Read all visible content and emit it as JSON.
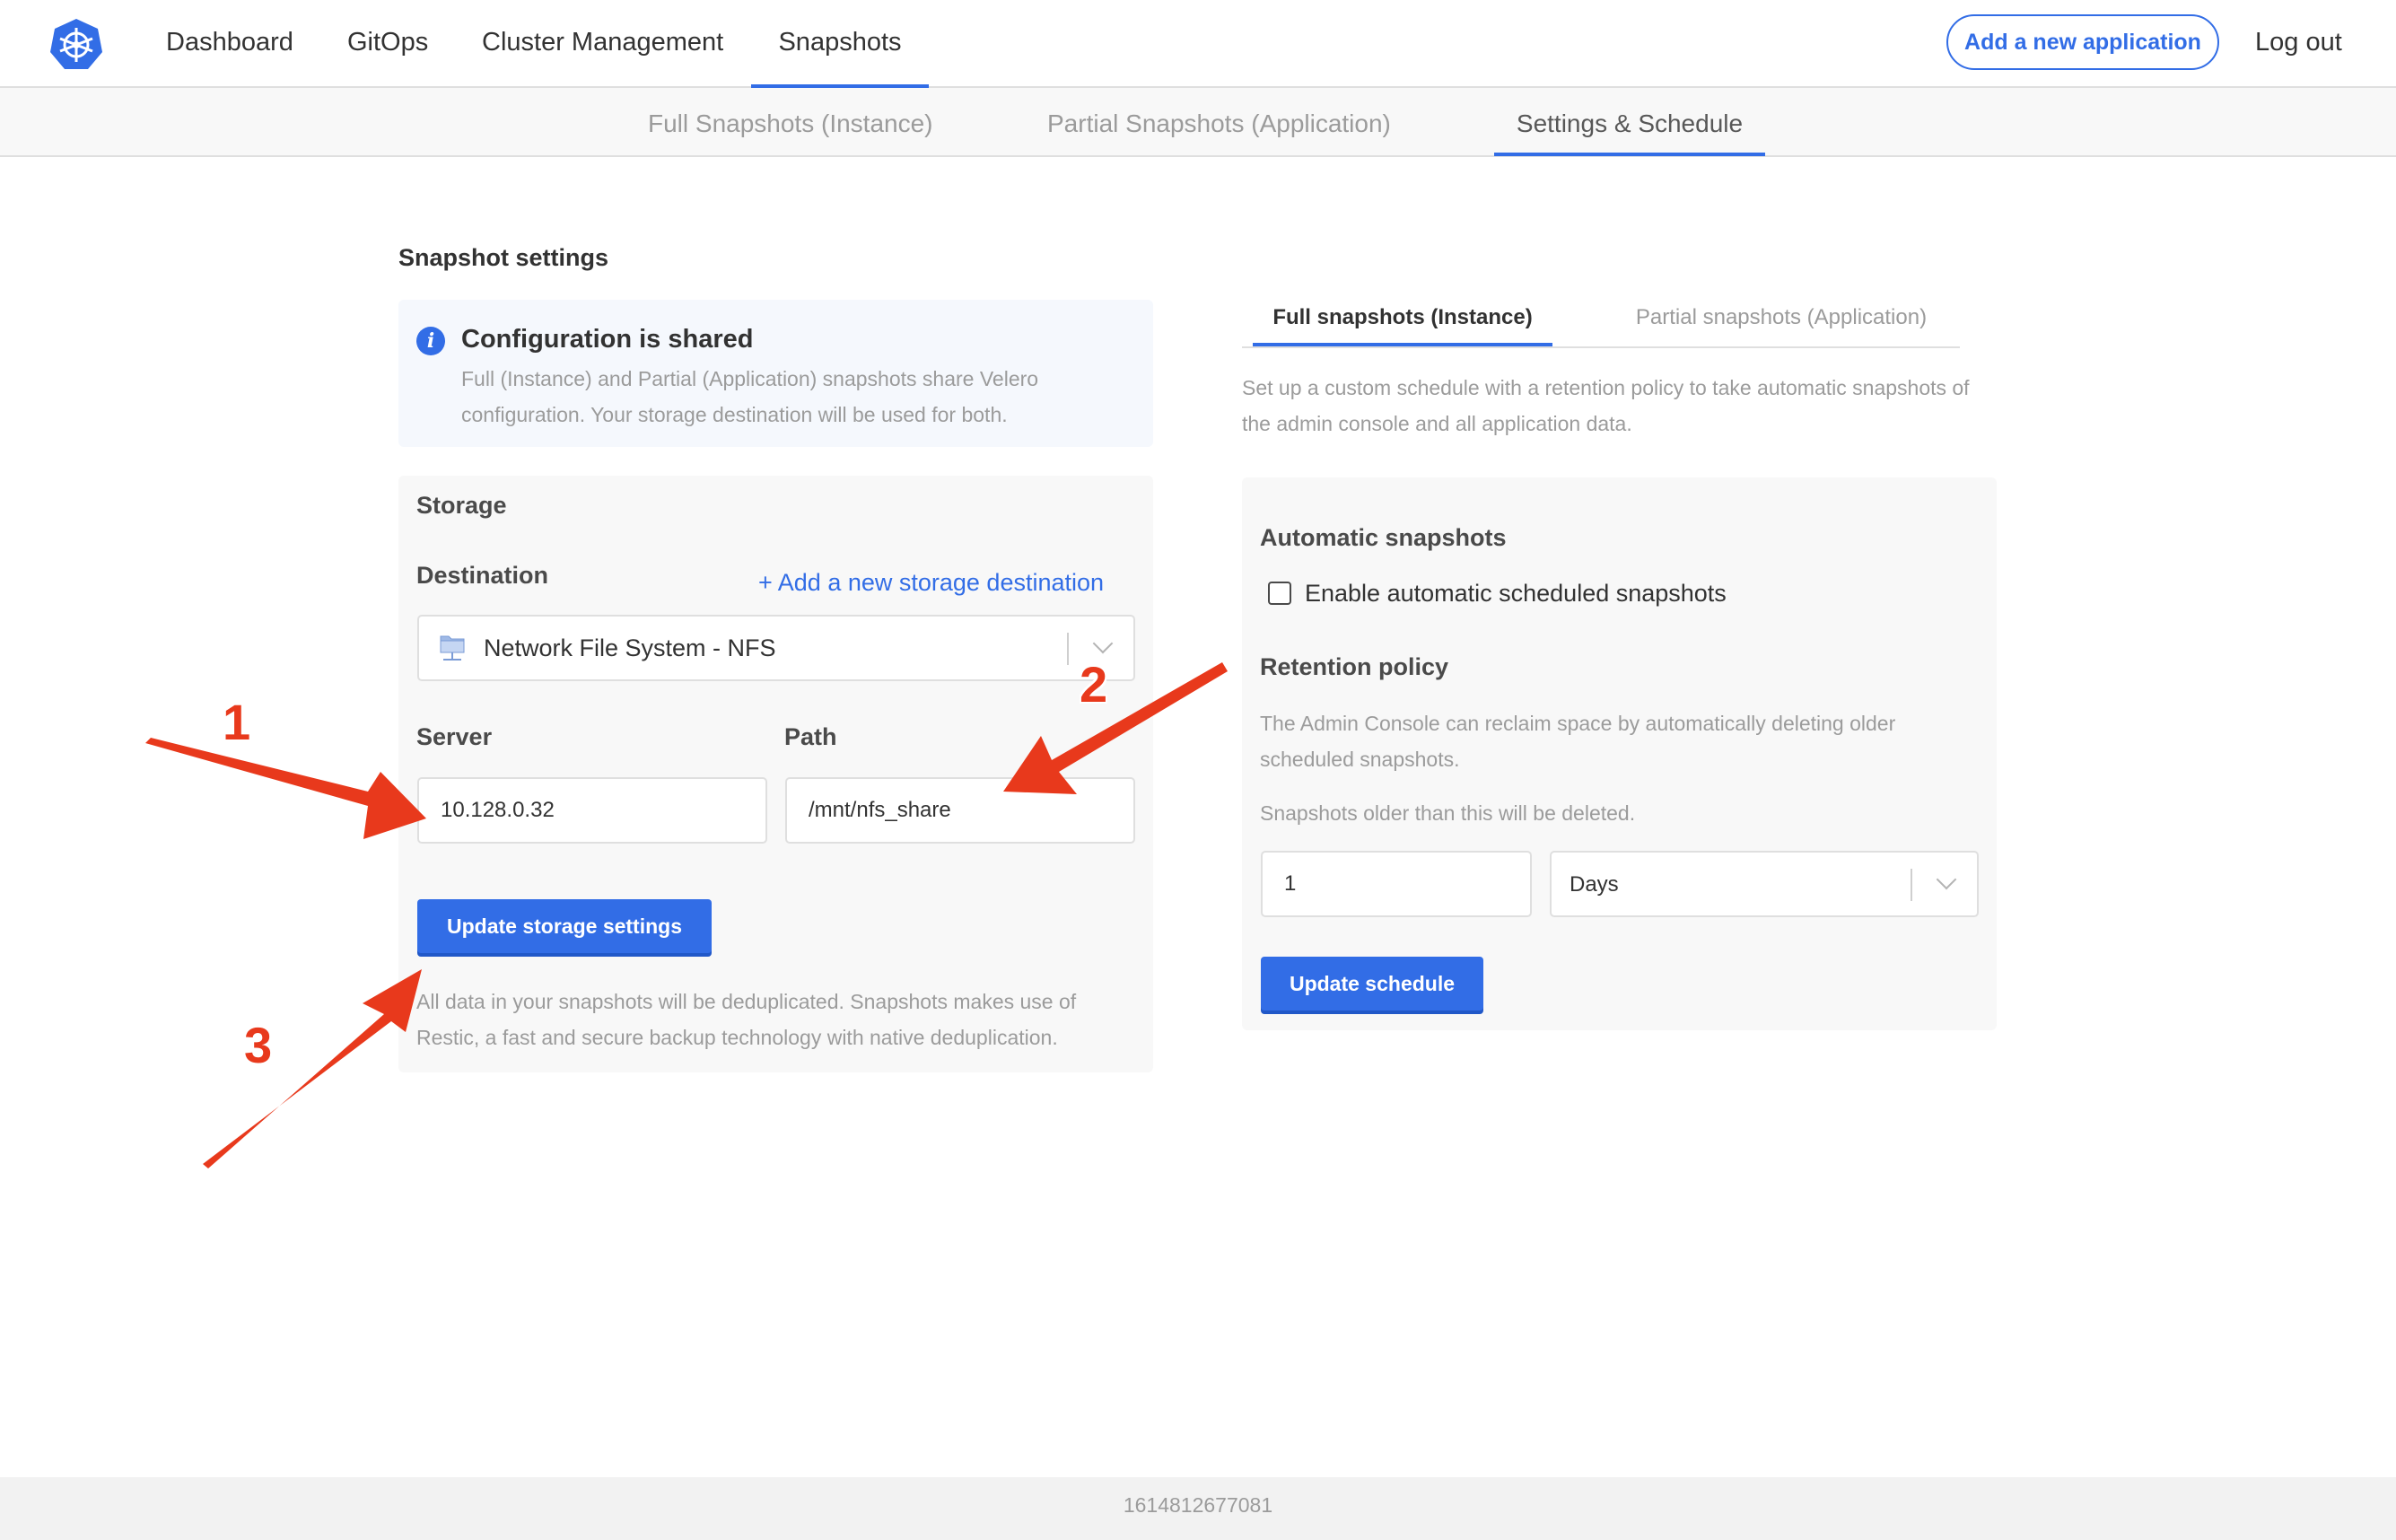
{
  "nav": {
    "items": [
      "Dashboard",
      "GitOps",
      "Cluster Management",
      "Snapshots"
    ],
    "add_application": "Add a new application",
    "logout": "Log out"
  },
  "subnav": {
    "items": [
      "Full Snapshots (Instance)",
      "Partial Snapshots (Application)",
      "Settings & Schedule"
    ]
  },
  "settings": {
    "title": "Snapshot settings",
    "info_title": "Configuration is shared",
    "info_text": "Full (Instance) and Partial (Application) snapshots share Velero configuration. Your storage destination will be used for both."
  },
  "storage": {
    "title": "Storage",
    "destination_label": "Destination",
    "add_destination": "+ Add a new storage destination",
    "destination_value": "Network File System - NFS",
    "server_label": "Server",
    "server_value": "10.128.0.32",
    "path_label": "Path",
    "path_value": "/mnt/nfs_share",
    "update_button": "Update storage settings",
    "dedup_note": "All data in your snapshots will be deduplicated. Snapshots makes use of Restic, a fast and secure backup technology with native deduplication."
  },
  "schedule": {
    "tabs": [
      "Full snapshots (Instance)",
      "Partial snapshots (Application)"
    ],
    "description": "Set up a custom schedule with a retention policy to take automatic snapshots of the admin console and all application data.",
    "auto_title": "Automatic snapshots",
    "auto_checkbox_label": "Enable automatic scheduled snapshots",
    "retention_title": "Retention policy",
    "retention_text": "The Admin Console can reclaim space by automatically deleting older scheduled snapshots.",
    "retention_hint": "Snapshots older than this will be deleted.",
    "retention_value": "1",
    "retention_unit": "Days",
    "update_button": "Update schedule"
  },
  "annotations": [
    "1",
    "2",
    "3"
  ],
  "footer": {
    "build": "1614812677081"
  },
  "colors": {
    "accent": "#326de6",
    "annotation": "#e8391c"
  }
}
